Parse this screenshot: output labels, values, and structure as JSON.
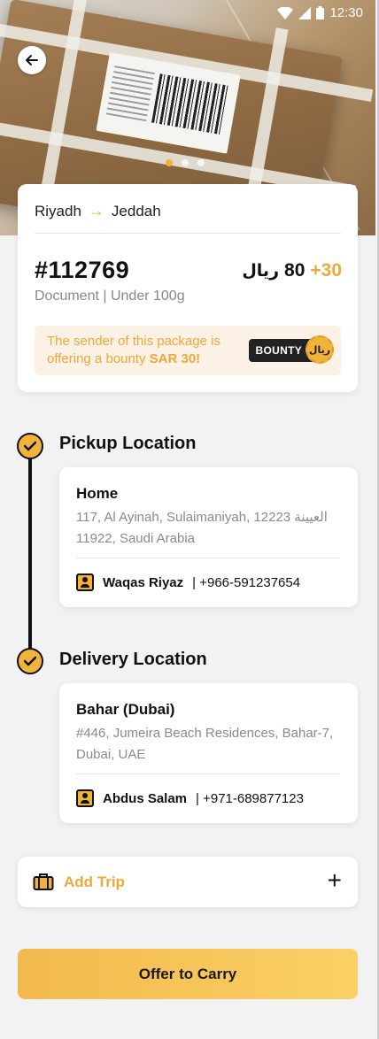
{
  "status_bar": {
    "time": "12:30",
    "icons": [
      "wifi-icon",
      "signal-icon",
      "battery-icon"
    ]
  },
  "hero": {
    "image": "cardboard package photo",
    "pager": {
      "pages": 3,
      "active_index": 0
    }
  },
  "summary": {
    "origin": "Riyadh",
    "destination": "Jeddah",
    "order_number": "#112769",
    "price": {
      "currency_symbol": "ریال",
      "base": "80",
      "bonus": "+30"
    },
    "details": "Document | Under 100g",
    "bounty": {
      "text_prefix": "The sender of this package is offering a bounty ",
      "amount": "SAR 30!",
      "badge_label": "BOUNTY",
      "badge_seal": "ریال"
    }
  },
  "pickup": {
    "title": "Pickup Location",
    "place_name": "Home",
    "address": "117, Al Ayinah, Sulaimaniyah, 12223 العيينة 11922, Saudi Arabia",
    "contact_name": "Waqas Riyaz",
    "contact_phone": " | +966-591237654"
  },
  "delivery": {
    "title": "Delivery Location",
    "place_name": "Bahar (Dubai)",
    "address": "#446, Jumeira Beach Residences, Bahar-7, Dubai, UAE",
    "contact_name": "Abdus Salam",
    "contact_phone": " | +971-689877123"
  },
  "add_trip": {
    "label": "Add Trip",
    "plus": "+"
  },
  "offer_button": {
    "label": "Offer to Carry"
  },
  "colors": {
    "accent": "#F0A83A",
    "button": "#F5C150",
    "dark": "#111111"
  }
}
